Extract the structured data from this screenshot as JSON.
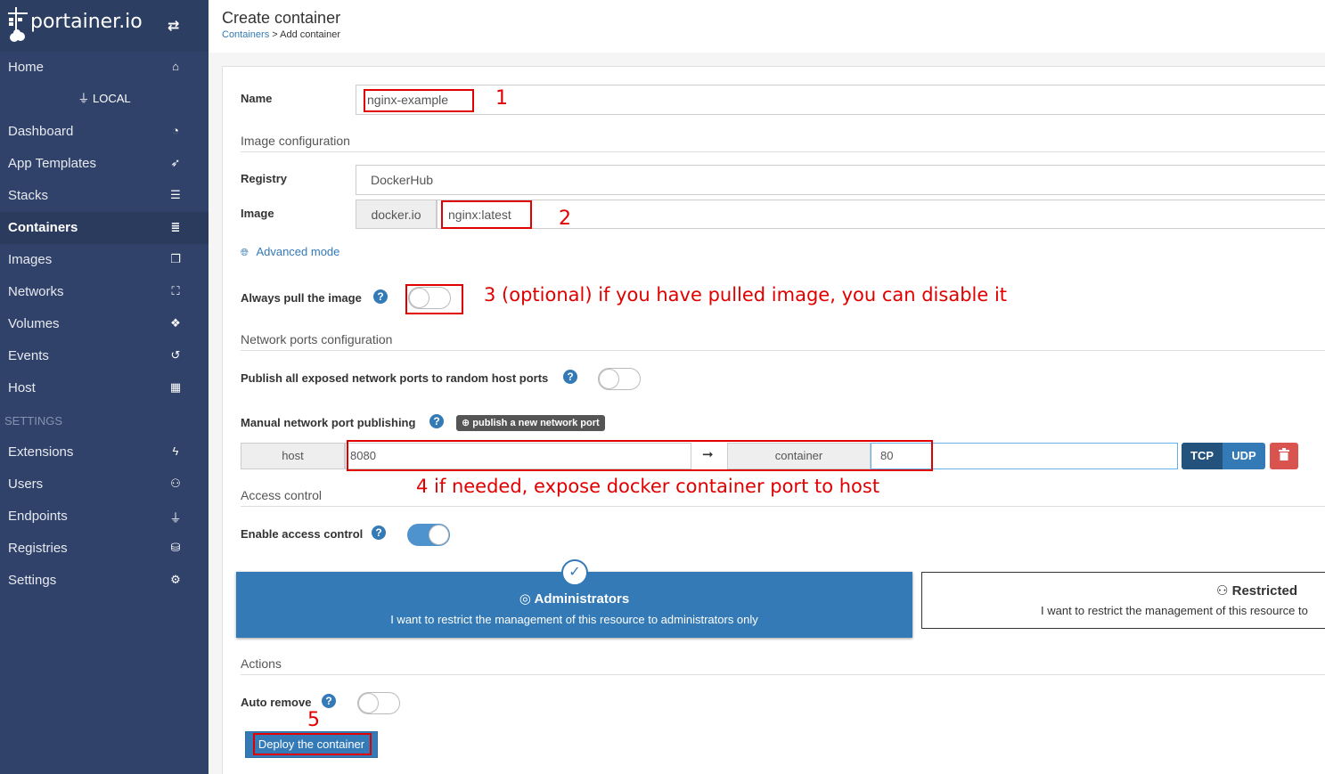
{
  "sidebar": {
    "brand": "portainer.io",
    "home": "Home",
    "endpoint": "LOCAL",
    "items": [
      "Dashboard",
      "App Templates",
      "Stacks",
      "Containers",
      "Images",
      "Networks",
      "Volumes",
      "Events",
      "Host"
    ],
    "settings_header": "SETTINGS",
    "settings_items": [
      "Extensions",
      "Users",
      "Endpoints",
      "Registries",
      "Settings"
    ]
  },
  "header": {
    "title": "Create container",
    "crumb_link": "Containers",
    "crumb_rest": "> Add container"
  },
  "form": {
    "name_label": "Name",
    "name_value": "nginx-example",
    "image_section": "Image configuration",
    "registry_label": "Registry",
    "registry_value": "DockerHub",
    "image_label": "Image",
    "image_prefix": "docker.io",
    "image_value": "nginx:latest",
    "advanced": "Advanced mode",
    "pull_label": "Always pull the image",
    "network_section": "Network ports configuration",
    "publish_all_label": "Publish all exposed network ports to random host ports",
    "manual_label": "Manual network port publishing",
    "publish_btn": "publish a new network port",
    "host_addon": "host",
    "host_value": "8080",
    "arrow": "➞",
    "container_addon": "container",
    "container_value": "80",
    "tcp": "TCP",
    "udp": "UDP",
    "access_section": "Access control",
    "access_label": "Enable access control",
    "admin_title": "Administrators",
    "admin_desc": "I want to restrict the management of this resource to administrators only",
    "restricted_title": "Restricted",
    "restricted_desc": "I want to restrict the management of this resource to",
    "actions_section": "Actions",
    "autoremove_label": "Auto remove",
    "deploy": "Deploy the container"
  },
  "annotations": {
    "a1": "1",
    "a2": "2",
    "a3": "3 (optional) if you have pulled image, you can disable it",
    "a4": "4 if needed, expose docker container port to host",
    "a5": "5"
  },
  "colors": {
    "sidebar": "#30426a",
    "accent": "#337ab7",
    "annotation": "#e10000"
  }
}
